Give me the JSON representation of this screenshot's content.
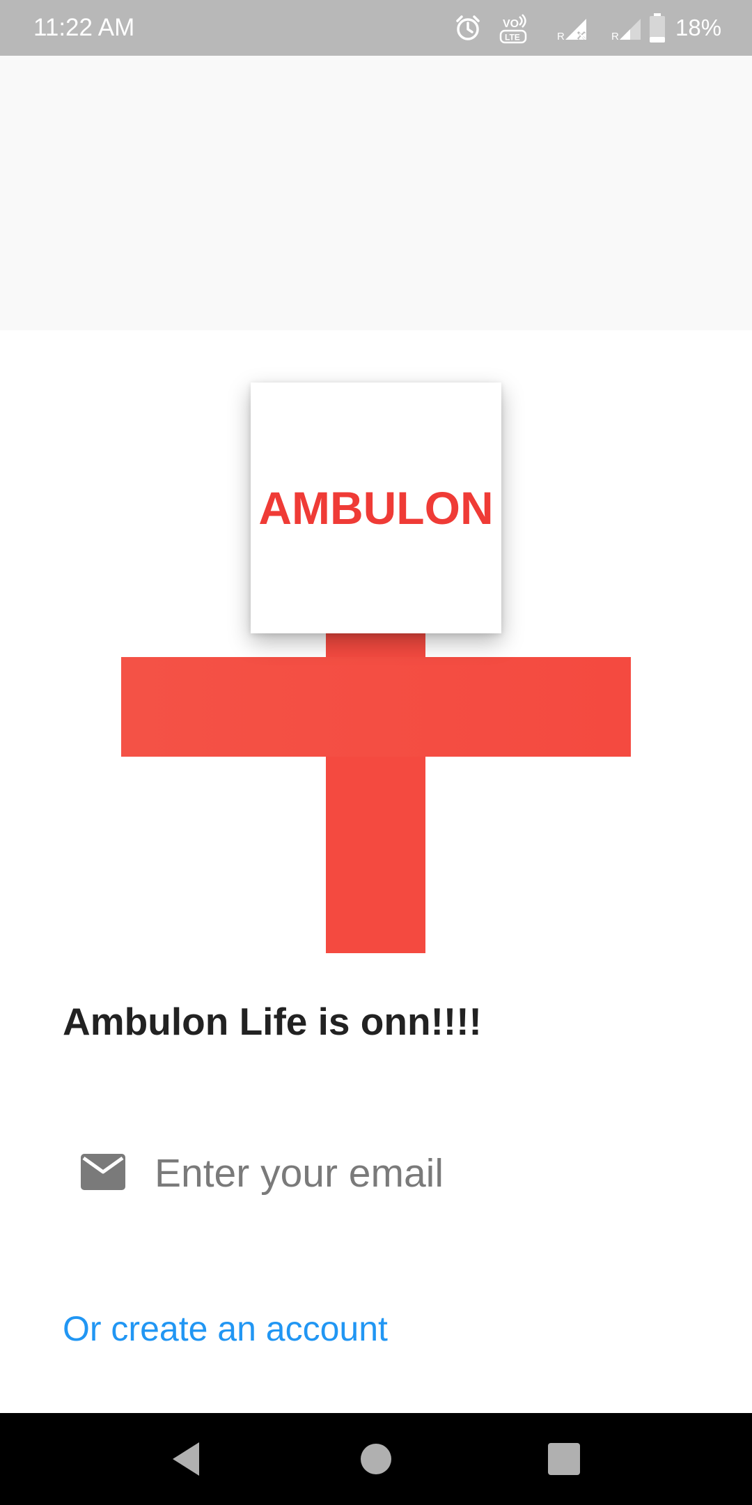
{
  "status_bar": {
    "time": "11:22 AM",
    "battery": "18%",
    "icons": [
      "alarm-icon",
      "volte-icon",
      "signal-roaming-x-icon",
      "signal-roaming-icon",
      "battery-icon"
    ]
  },
  "logo": {
    "text": "AMBULON",
    "accent_color": "#ef3b36",
    "cross_color": "#f44a40"
  },
  "main": {
    "welcome_text": "Ambulon Life is onn!!!!",
    "email_placeholder": "Enter your email",
    "email_value": "",
    "email_icon": "mail-icon",
    "create_account_label": "Or create an account",
    "link_color": "#2196f3"
  },
  "nav_bar": {
    "buttons": [
      "back-icon",
      "home-icon",
      "recents-icon"
    ]
  }
}
